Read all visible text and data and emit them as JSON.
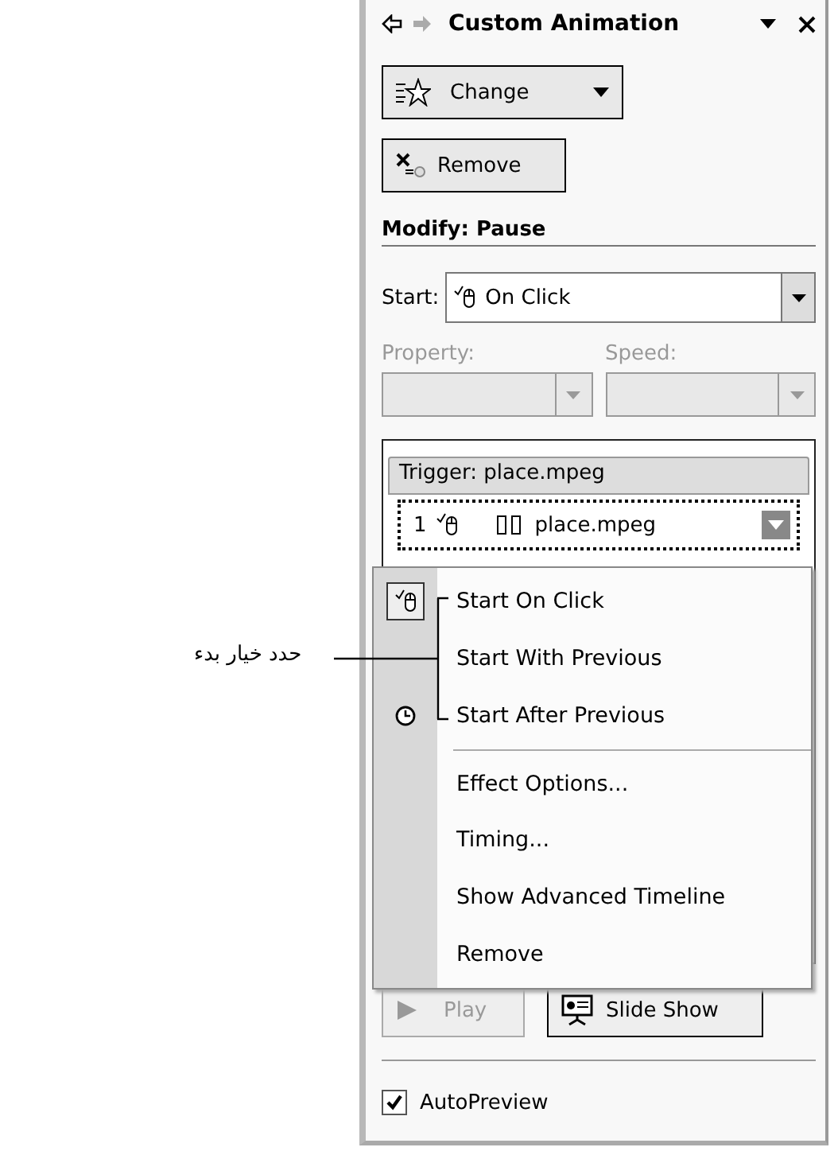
{
  "annotation": {
    "text": "حدد خيار بدء"
  },
  "pane": {
    "title": "Custom Animation",
    "change_button": "Change",
    "remove_button": "Remove",
    "section_title": "Modify: Pause",
    "start": {
      "label": "Start:",
      "value": "On Click"
    },
    "property": {
      "label": "Property:",
      "disabled": true
    },
    "speed": {
      "label": "Speed:",
      "disabled": true
    },
    "list": {
      "trigger": "Trigger: place.mpeg",
      "items": [
        {
          "number": "1",
          "name": "place.mpeg",
          "selected": true
        }
      ]
    },
    "play_button": {
      "label": "Play",
      "disabled": true
    },
    "slideshow_button": "Slide Show",
    "autopreview": {
      "label": "AutoPreview",
      "checked": true
    }
  },
  "context_menu": {
    "items": [
      {
        "kind": "onclick",
        "label": "Start On Click",
        "checked": true
      },
      {
        "kind": "withprevious",
        "label": "Start With Previous",
        "checked": false
      },
      {
        "kind": "afterprevious",
        "label": "Start After Previous",
        "checked": false
      },
      {
        "kind": "separator"
      },
      {
        "kind": "command",
        "label": "Effect Options..."
      },
      {
        "kind": "command",
        "label": "Timing..."
      },
      {
        "kind": "command",
        "label": "Show Advanced Timeline"
      },
      {
        "kind": "command",
        "label": "Remove"
      }
    ]
  }
}
